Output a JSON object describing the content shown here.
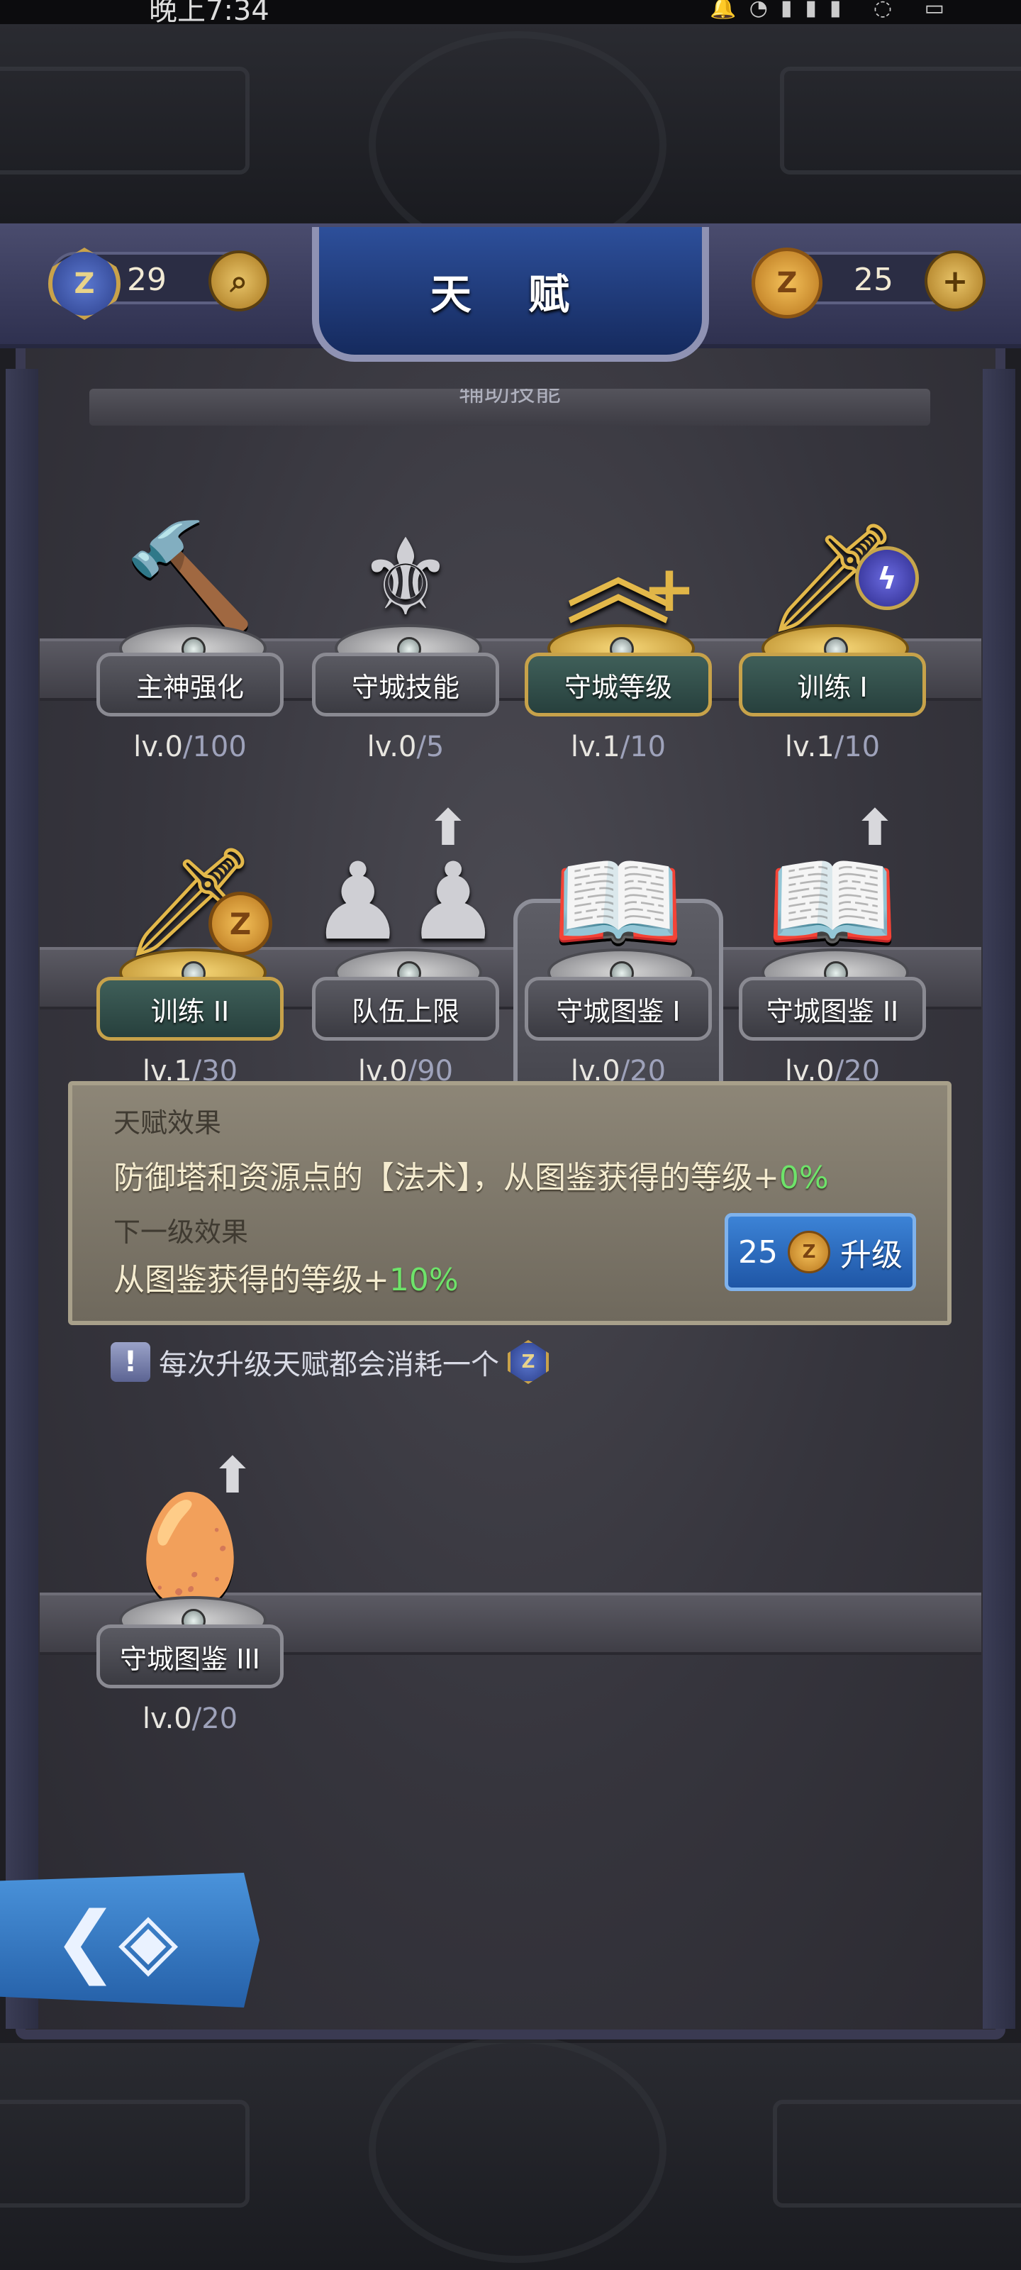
{
  "status_bar": {
    "time": "晚上7:34"
  },
  "header": {
    "title": "天 赋",
    "talent_points": "29",
    "coins": "25",
    "section_label": "辅助技能"
  },
  "icons": {
    "talent_point": "talent-medal-icon",
    "search": "search-icon",
    "coin": "coin-icon",
    "add": "plus-icon",
    "back": "back-emblem-icon",
    "notice": "exclamation-icon"
  },
  "talents": [
    {
      "name": "主神强化",
      "level": "lv.0",
      "max": "/100",
      "icon": "hammer-icon"
    },
    {
      "name": "守城技能",
      "level": "lv.0",
      "max": "/5",
      "icon": "trident-crest-icon"
    },
    {
      "name": "守城等级",
      "level": "lv.1",
      "max": "/10",
      "icon": "rank-chevron-plus-icon"
    },
    {
      "name": "训练 I",
      "level": "lv.1",
      "max": "/10",
      "icon": "sword-bolt-icon"
    },
    {
      "name": "训练 II",
      "level": "lv.1",
      "max": "/30",
      "icon": "sword-coin-icon"
    },
    {
      "name": "队伍上限",
      "level": "lv.0",
      "max": "/90",
      "icon": "team-figures-icon"
    },
    {
      "name": "守城图鉴 I",
      "level": "lv.0",
      "max": "/20",
      "icon": "book-shield-icon"
    },
    {
      "name": "守城图鉴 II",
      "level": "lv.0",
      "max": "/20",
      "icon": "book-crest-icon"
    },
    {
      "name": "守城图鉴 III",
      "level": "lv.0",
      "max": "/20",
      "icon": "book-egg-icon"
    }
  ],
  "info": {
    "effect_label": "天赋效果",
    "effect_text": "防御塔和资源点的【法术】，从图鉴获得的等级+",
    "effect_value": "0%",
    "next_label": "下一级效果",
    "next_text": "从图鉴获得的等级+",
    "next_value": "10%",
    "upgrade_cost": "25",
    "upgrade_label": "升级"
  },
  "notice": {
    "text": "每次升级天赋都会消耗一个"
  },
  "colors": {
    "panel": "#36353d",
    "gold": "#e3b84a",
    "button_blue": "#2f6fc2",
    "positive_green": "#6ee36a"
  }
}
